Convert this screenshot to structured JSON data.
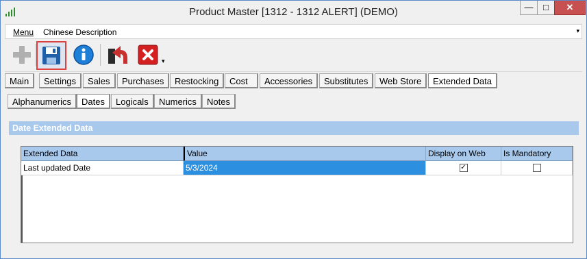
{
  "window": {
    "title": "Product Master [1312 - 1312 ALERT] (DEMO)",
    "controls": {
      "minimize": "—",
      "maximize": "□",
      "close": "✕"
    }
  },
  "menu": {
    "items": [
      "Menu",
      "Chinese Description"
    ],
    "dropdown": "▾"
  },
  "toolbar": {
    "buttons": [
      {
        "name": "add",
        "icon": "plus-icon"
      },
      {
        "name": "save",
        "icon": "save-icon",
        "highlighted": true
      },
      {
        "name": "info",
        "icon": "info-icon"
      },
      {
        "name": "undo",
        "icon": "undo-icon"
      },
      {
        "name": "close",
        "icon": "close-icon"
      }
    ],
    "dropdown": "▾"
  },
  "main_tabs": [
    "Main",
    "Settings",
    "Sales",
    "Purchases",
    "Restocking",
    "Cost",
    "Accessories",
    "Substitutes",
    "Web Store",
    "Extended Data"
  ],
  "main_tabs_active": "Extended Data",
  "sub_tabs": [
    "Alphanumerics",
    "Dates",
    "Logicals",
    "Numerics",
    "Notes"
  ],
  "sub_tabs_active": "Dates",
  "section": {
    "title": "Date Extended Data"
  },
  "grid": {
    "columns": [
      "Extended Data",
      "Value",
      "Display on Web",
      "Is Mandatory"
    ],
    "rows": [
      {
        "extended_data": "Last updated Date",
        "value": "5/3/2024",
        "display_on_web": true,
        "is_mandatory": false
      }
    ]
  },
  "colors": {
    "accent": "#2d8fdf",
    "header": "#a8c8ec",
    "highlight_border": "#e04040",
    "close": "#c75050"
  }
}
